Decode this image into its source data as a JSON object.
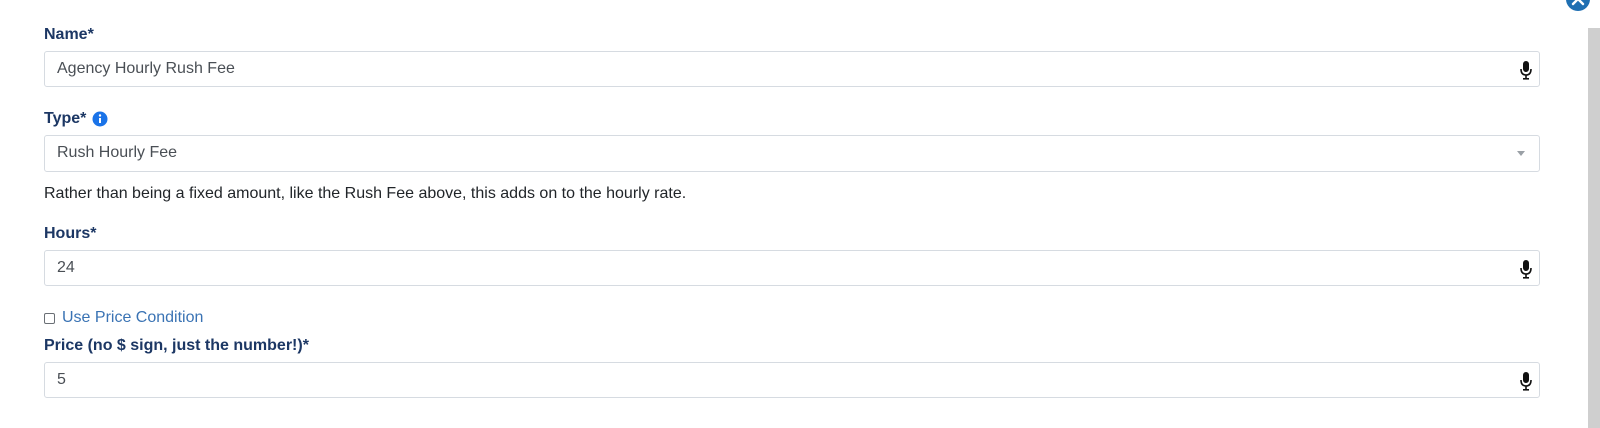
{
  "form": {
    "name_label": "Name*",
    "name_value": "Agency Hourly Rush Fee",
    "type_label": "Type*",
    "type_value": "Rush Hourly Fee",
    "type_help": "Rather than being a fixed amount, like the Rush Fee above, this adds on to the hourly rate.",
    "hours_label": "Hours*",
    "hours_value": "24",
    "price_condition_label": "Use Price Condition",
    "price_condition_checked": false,
    "price_label": "Price (no $ sign, just the number!)*",
    "price_value": "5"
  },
  "icons": {
    "close": "close-icon",
    "info": "info-icon",
    "mic": "microphone-icon",
    "dropdown": "chevron-down-icon"
  },
  "colors": {
    "label": "#1c3764",
    "accent": "#1a73e8",
    "link": "#3a73b4",
    "border": "#d6dbe1"
  }
}
